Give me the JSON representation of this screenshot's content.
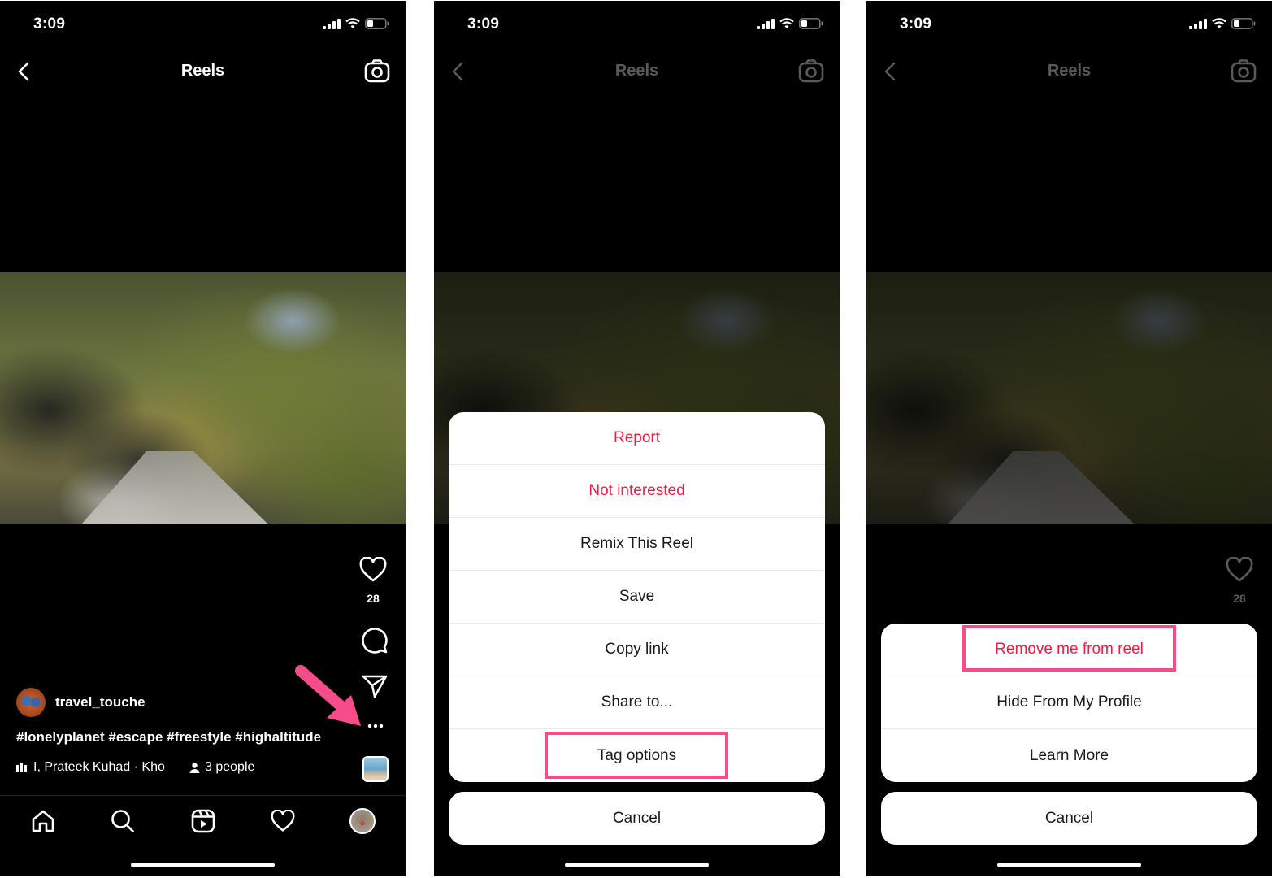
{
  "colors": {
    "highlight": "#f74c8c",
    "danger_text": "#ed1c44",
    "background": "#000000"
  },
  "status_bar": {
    "time": "3:09",
    "icons": [
      "cellular-signal-icon",
      "wifi-icon",
      "battery-icon"
    ]
  },
  "header": {
    "back_icon": "chevron-left-icon",
    "title": "Reels",
    "camera_icon": "camera-icon"
  },
  "reel": {
    "like_count": "28",
    "author": "travel_touche",
    "caption": "#lonelyplanet #escape #freestyle #highaltitude",
    "music": "I, Prateek Kuhad · Kho",
    "tagged_people": "3 people",
    "actions": [
      "heart-icon",
      "comment-icon",
      "share-icon",
      "more-options-icon"
    ]
  },
  "tab_bar": {
    "items": [
      "home-icon",
      "search-icon",
      "reels-icon",
      "activity-heart-icon",
      "profile-avatar"
    ]
  },
  "screen2_menu": {
    "items": [
      {
        "label": "Report",
        "style": "danger"
      },
      {
        "label": "Not interested",
        "style": "danger"
      },
      {
        "label": "Remix This Reel",
        "style": "normal"
      },
      {
        "label": "Save",
        "style": "normal"
      },
      {
        "label": "Copy link",
        "style": "normal"
      },
      {
        "label": "Share to...",
        "style": "normal"
      },
      {
        "label": "Tag options",
        "style": "normal",
        "highlighted": true
      }
    ],
    "cancel": "Cancel"
  },
  "screen3_menu": {
    "items": [
      {
        "label": "Remove me from reel",
        "style": "danger",
        "highlighted": true
      },
      {
        "label": "Hide From My Profile",
        "style": "normal"
      },
      {
        "label": "Learn More",
        "style": "normal"
      }
    ],
    "cancel": "Cancel"
  }
}
